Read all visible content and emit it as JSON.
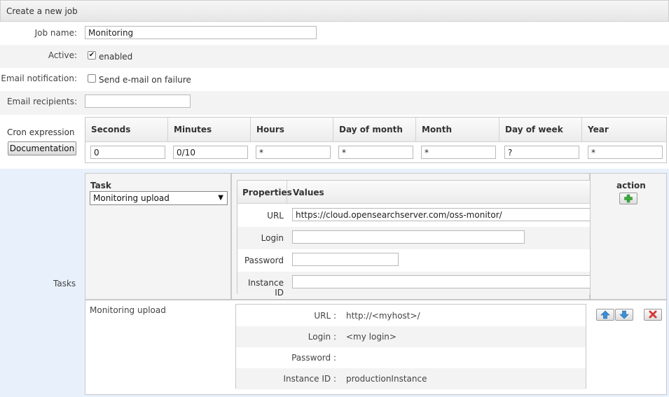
{
  "header": {
    "title": "Create a new job"
  },
  "job_name": {
    "label": "Job name:",
    "value": "Monitoring"
  },
  "active": {
    "label": "Active:",
    "checkbox_label": "enabled",
    "checked": true
  },
  "email_notification": {
    "label": "Email notification:",
    "checkbox_label": "Send e-mail on failure",
    "checked": false
  },
  "email_recipients": {
    "label": "Email recipients:",
    "value": ""
  },
  "cron": {
    "label": "Cron expression",
    "documentation_button": "Documentation",
    "columns": [
      {
        "header": "Seconds",
        "value": "0"
      },
      {
        "header": "Minutes",
        "value": "0/10"
      },
      {
        "header": "Hours",
        "value": "*"
      },
      {
        "header": "Day of month",
        "value": "*"
      },
      {
        "header": "Month",
        "value": "*"
      },
      {
        "header": "Day of week",
        "value": "?"
      },
      {
        "header": "Year",
        "value": "*"
      }
    ]
  },
  "tasks": {
    "label": "Tasks",
    "task_header": "Task",
    "selected_task": "Monitoring upload",
    "properties_header": "Properties",
    "values_header": "Values",
    "properties": [
      {
        "name": "URL",
        "value": "https://cloud.opensearchserver.com/oss-monitor/"
      },
      {
        "name": "Login",
        "value": ""
      },
      {
        "name": "Password",
        "value": ""
      },
      {
        "name": "Instance ID",
        "value": ""
      }
    ],
    "action_header": "action",
    "existing_task": {
      "name": "Monitoring upload",
      "rows": [
        {
          "label": "URL :",
          "value": "http://<myhost>/"
        },
        {
          "label": "Login :",
          "value": "<my login>"
        },
        {
          "label": "Password :",
          "value": ""
        },
        {
          "label": "Instance ID :",
          "value": "productionInstance"
        }
      ]
    }
  },
  "colors": {
    "tasks_background": "#e8f1fb",
    "add_icon": "#3cae3c",
    "move_icons": "#3a8fd8",
    "delete_icon": "#d63a3a"
  },
  "icons": {
    "add": "plus-icon",
    "move_up": "arrow-up-icon",
    "move_down": "arrow-down-icon",
    "delete": "close-icon"
  }
}
